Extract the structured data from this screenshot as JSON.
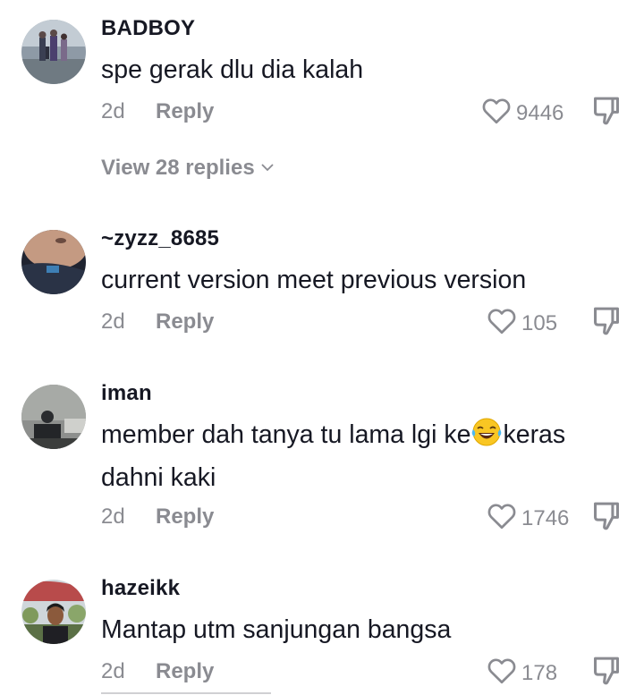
{
  "comments": [
    {
      "username": "BADBOY",
      "text": "spe gerak dlu dia kalah",
      "time": "2d",
      "reply_label": "Reply",
      "likes": "9446",
      "view_replies": "View 28 replies"
    },
    {
      "username": "~zyzz_8685",
      "text": "current version meet previous version",
      "time": "2d",
      "reply_label": "Reply",
      "likes": "105"
    },
    {
      "username": "iman",
      "text_before_emoji": "member dah tanya tu lama lgi ke",
      "text_after_emoji": "keras",
      "text_line2": "dahni kaki",
      "emoji": "face-with-tears-of-joy",
      "time": "2d",
      "reply_label": "Reply",
      "likes": "1746"
    },
    {
      "username": "hazeikk",
      "text": "Mantap utm sanjungan bangsa",
      "time": "2d",
      "reply_label": "Reply",
      "likes": "178"
    }
  ],
  "icons": {
    "like": "heart-outline-icon",
    "dislike": "thumbs-down-icon",
    "expand": "chevron-down-icon"
  },
  "colors": {
    "text_primary": "#161823",
    "text_secondary": "#8a8b91"
  }
}
